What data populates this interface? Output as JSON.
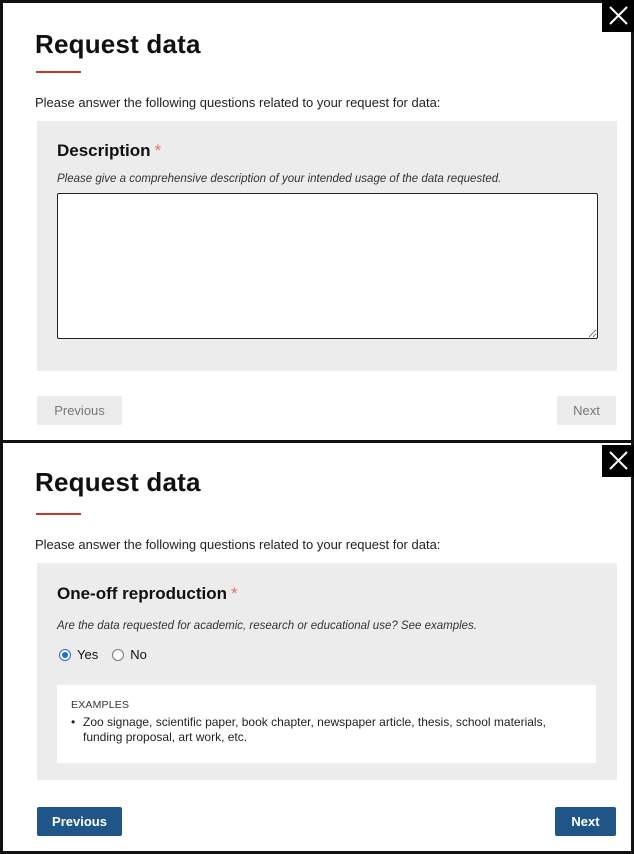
{
  "modal1": {
    "title": "Request data",
    "intro": "Please answer the following questions related to your request for data:",
    "field": {
      "label": "Description",
      "required_mark": "*",
      "help": "Please give a comprehensive description of your intended usage of the data requested.",
      "value": ""
    },
    "buttons": {
      "previous": "Previous",
      "next": "Next"
    }
  },
  "modal2": {
    "title": "Request data",
    "intro": "Please answer the following questions related to your request for data:",
    "field": {
      "label": "One-off reproduction",
      "required_mark": "*",
      "help": "Are the data requested for academic, research or educational use? See examples.",
      "options": [
        {
          "label": "Yes",
          "checked": true
        },
        {
          "label": "No",
          "checked": false
        }
      ]
    },
    "examples": {
      "heading": "EXAMPLES",
      "items": [
        "Zoo signage, scientific paper, book chapter, newspaper article, thesis, school materials, funding proposal, art work, etc."
      ]
    },
    "buttons": {
      "previous": "Previous",
      "next": "Next"
    }
  },
  "icons": {
    "close": "close-icon",
    "radio": "radio-icon"
  },
  "colors": {
    "accent_red": "#c0392b",
    "primary_blue": "#1f5687",
    "panel_grey": "#ececec"
  }
}
